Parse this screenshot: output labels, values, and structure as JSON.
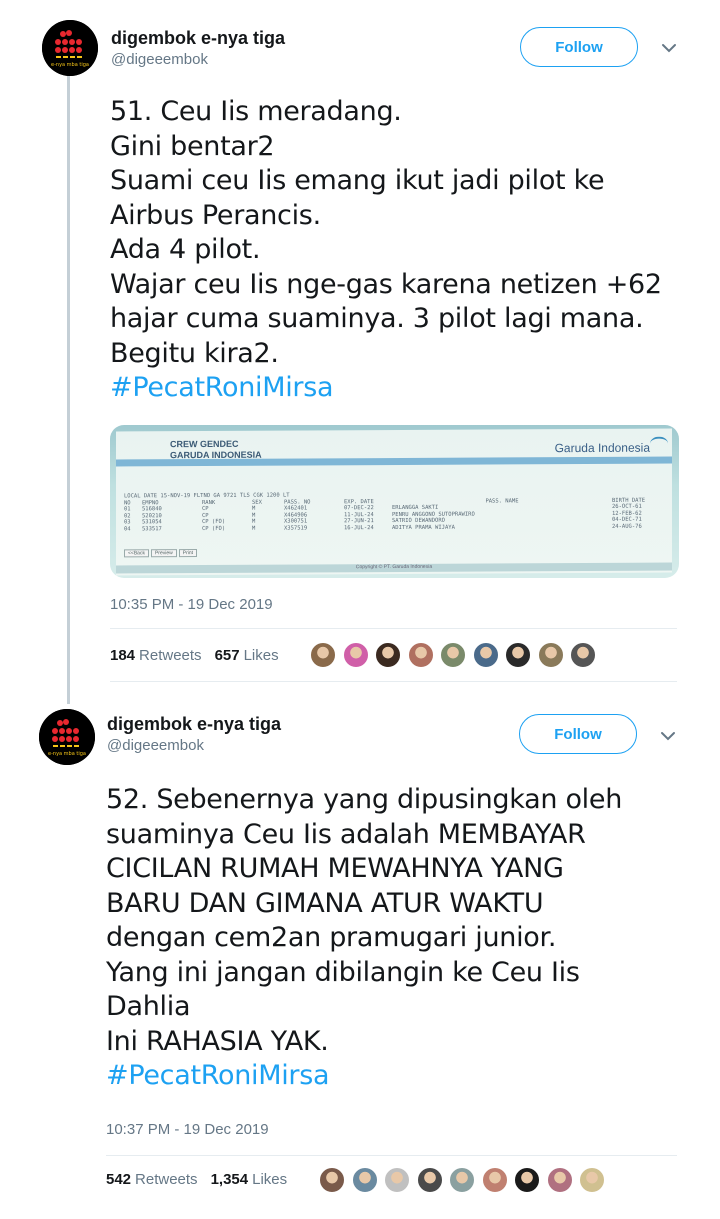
{
  "tweets": [
    {
      "author": {
        "name": "digembok e-nya tiga",
        "handle": "@digeeembok",
        "avatar_label": "e-nya mba tiga"
      },
      "follow_label": "Follow",
      "text_lines": [
        "51. Ceu Iis meradang.",
        "Gini bentar2",
        "Suami ceu Iis emang ikut jadi pilot ke",
        "Airbus Perancis.",
        "Ada 4 pilot.",
        "Wajar ceu Iis nge-gas karena netizen +62",
        "hajar cuma suaminya. 3 pilot lagi mana.",
        "Begitu kira2."
      ],
      "hashtag": "#PecatRoniMirsa",
      "media": {
        "title_line1": "CREW GENDEC",
        "title_line2": "GARUDA INDONESIA",
        "logo_text": "Garuda Indonesia",
        "header_info": "LOCAL DATE 15-NOV-19 FLTNO GA 9721 TLS CGK 1200 LT",
        "columns": [
          "NO",
          "EMPNO",
          "RANK",
          "SEX",
          "PASS. NO",
          "EXP. DATE",
          "PASS. NAME",
          "BIRTH DATE"
        ],
        "rows": [
          [
            "01",
            "516840",
            "CP",
            "M",
            "X462401",
            "07-DEC-22",
            "ERLANGGA SAKTI",
            "26-OCT-61"
          ],
          [
            "02",
            "520210",
            "CP",
            "M",
            "X464906",
            "11-JUL-24",
            "PENRU ANGGONO SUTOPRAWIRO",
            "12-FEB-62"
          ],
          [
            "03",
            "531054",
            "CP (FO)",
            "M",
            "X300751",
            "27-JUN-21",
            "SATRIO DEWANDORO",
            "04-DEC-71"
          ],
          [
            "04",
            "533517",
            "CP (FO)",
            "M",
            "X357519",
            "16-JUL-24",
            "ADITYA PRAMA WIJAYA",
            "24-AUG-76"
          ]
        ],
        "buttons": [
          "<<Back",
          "Preview",
          "Print"
        ],
        "footer": "Copyright © PT. Garuda Indonesia"
      },
      "timestamp": "10:35 PM - 19 Dec 2019",
      "retweets_count": "184",
      "retweets_label": "Retweets",
      "likes_count": "657",
      "likes_label": "Likes",
      "liker_colors": [
        "#8a6a4a",
        "#d05fa8",
        "#3b2a20",
        "#b07060",
        "#7a8a6a",
        "#4a6a8a",
        "#2a2a2a",
        "#8a7a5a",
        "#555555"
      ]
    },
    {
      "author": {
        "name": "digembok e-nya tiga",
        "handle": "@digeeembok",
        "avatar_label": "e-nya mba tiga"
      },
      "follow_label": "Follow",
      "text_lines": [
        "52. Sebenernya yang dipusingkan oleh",
        "suaminya Ceu Iis adalah MEMBAYAR",
        "CICILAN RUMAH MEWAHNYA YANG",
        "BARU DAN GIMANA ATUR WAKTU",
        "dengan cem2an pramugari junior.",
        "Yang ini jangan dibilangin ke Ceu Iis",
        "Dahlia",
        "Ini RAHASIA YAK."
      ],
      "hashtag": "#PecatRoniMirsa",
      "timestamp": "10:37 PM - 19 Dec 2019",
      "retweets_count": "542",
      "retweets_label": "Retweets",
      "likes_count": "1,354",
      "likes_label": "Likes",
      "liker_colors": [
        "#7a5a4a",
        "#6a8aa0",
        "#c0c0c0",
        "#4a4a4a",
        "#8aa0a0",
        "#c08070",
        "#1a1a1a",
        "#b07080",
        "#d0c090"
      ]
    }
  ],
  "colors": {
    "accent": "#1da1f2",
    "text": "#14171a",
    "muted": "#657786",
    "thread_line": "#c4cfd6"
  }
}
